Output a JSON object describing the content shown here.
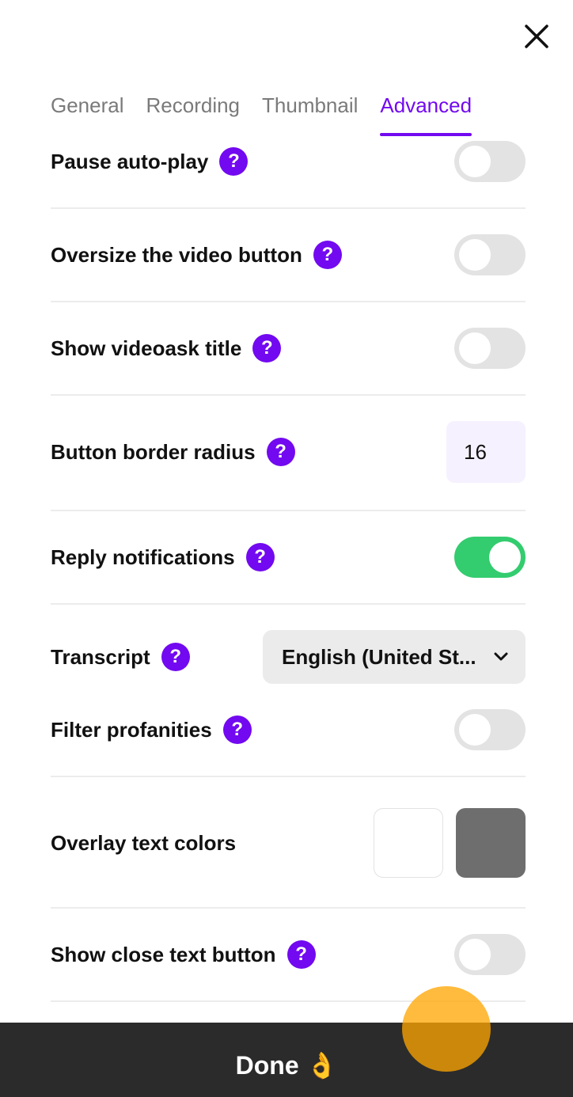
{
  "header": {
    "close_icon": "close-icon"
  },
  "tabs": [
    {
      "label": "General",
      "active": false
    },
    {
      "label": "Recording",
      "active": false
    },
    {
      "label": "Thumbnail",
      "active": false
    },
    {
      "label": "Advanced",
      "active": true
    }
  ],
  "settings": {
    "pause_autoplay": {
      "label": "Pause auto-play",
      "help": "?",
      "enabled": false
    },
    "oversize_video_button": {
      "label": "Oversize the video button",
      "help": "?",
      "enabled": false
    },
    "show_title": {
      "label": "Show videoask title",
      "help": "?",
      "enabled": false
    },
    "button_border_radius": {
      "label": "Button border radius",
      "help": "?",
      "value": "16"
    },
    "reply_notifications": {
      "label": "Reply notifications",
      "help": "?",
      "enabled": true
    },
    "transcript": {
      "label": "Transcript",
      "help": "?",
      "selected": "English (United St..."
    },
    "filter_profanities": {
      "label": "Filter profanities",
      "help": "?",
      "enabled": false
    },
    "overlay_text_colors": {
      "label": "Overlay text colors",
      "colors": [
        "#ffffff",
        "#6e6e6e"
      ]
    },
    "show_close_text_button": {
      "label": "Show close text button",
      "help": "?",
      "enabled": false
    }
  },
  "footer": {
    "done_label": "Done 👌"
  },
  "colors": {
    "accent": "#7209f0",
    "toggle_on": "#33cc6e",
    "toggle_off": "#e3e3e3",
    "footer_bg": "#2b2b2b"
  }
}
